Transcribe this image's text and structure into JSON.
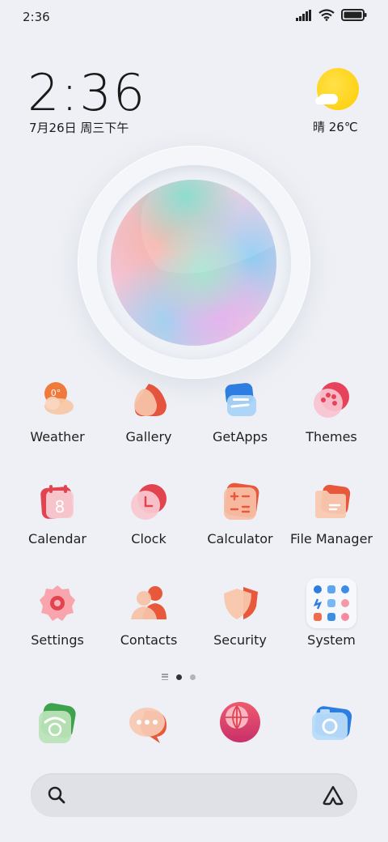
{
  "status_bar": {
    "time": "2:36"
  },
  "clock_widget": {
    "time": "2:36",
    "date": "7月26日 周三下午"
  },
  "weather_widget": {
    "text": "晴 26℃"
  },
  "apps": [
    {
      "label": "Weather",
      "icon": "weather-icon"
    },
    {
      "label": "Gallery",
      "icon": "gallery-icon"
    },
    {
      "label": "GetApps",
      "icon": "getapps-icon"
    },
    {
      "label": "Themes",
      "icon": "themes-icon"
    },
    {
      "label": "Calendar",
      "icon": "calendar-icon",
      "icon_text": "8"
    },
    {
      "label": "Clock",
      "icon": "clock-icon"
    },
    {
      "label": "Calculator",
      "icon": "calculator-icon"
    },
    {
      "label": "File Manager",
      "icon": "file-manager-icon"
    },
    {
      "label": "Settings",
      "icon": "settings-icon"
    },
    {
      "label": "Contacts",
      "icon": "contacts-icon"
    },
    {
      "label": "Security",
      "icon": "security-icon"
    },
    {
      "label": "System",
      "icon": "system-folder-icon"
    }
  ],
  "page_indicator": {
    "pages": 2,
    "current": 1
  },
  "dock": [
    {
      "icon": "phone-icon"
    },
    {
      "icon": "messages-icon"
    },
    {
      "icon": "browser-icon"
    },
    {
      "icon": "camera-icon"
    }
  ],
  "colors": {
    "background": "#eef0f5",
    "sun": "#ffcc00",
    "active_dot": "#333333",
    "inactive_dot": "#b0b4bb"
  }
}
